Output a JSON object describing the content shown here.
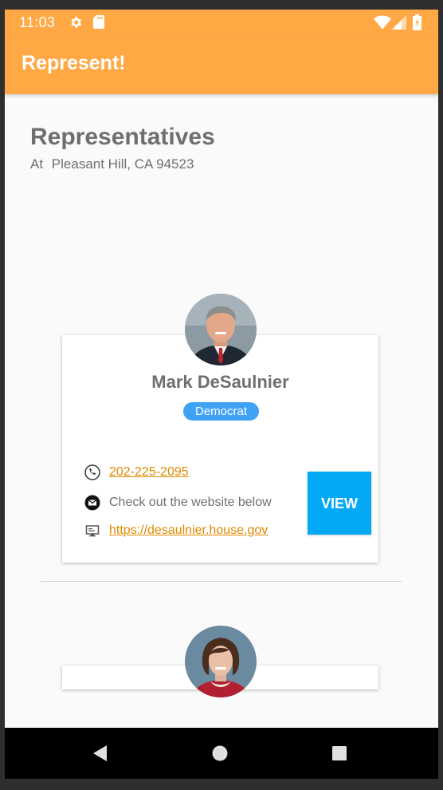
{
  "status_bar": {
    "time": "11:03",
    "icons": [
      "gear-icon",
      "sd-card-icon",
      "wifi-icon",
      "signal-icon",
      "battery-icon"
    ]
  },
  "app_bar": {
    "title": "Represent!"
  },
  "main": {
    "heading": "Representatives",
    "location_prefix": "At",
    "location": "Pleasant Hill, CA 94523"
  },
  "representatives": [
    {
      "name": "Mark DeSaulnier",
      "party": "Democrat",
      "phone": "202-225-2095",
      "email_text": "Check out the website below",
      "website": "https://desaulnier.house.gov",
      "view_label": "VIEW"
    }
  ],
  "colors": {
    "accent": "#ffa844",
    "party_badge": "#3fa2f5",
    "view_button": "#03a9f4",
    "link": "#e08a00"
  },
  "nav_bar": {
    "icons": [
      "back-icon",
      "home-icon",
      "recents-icon"
    ]
  }
}
